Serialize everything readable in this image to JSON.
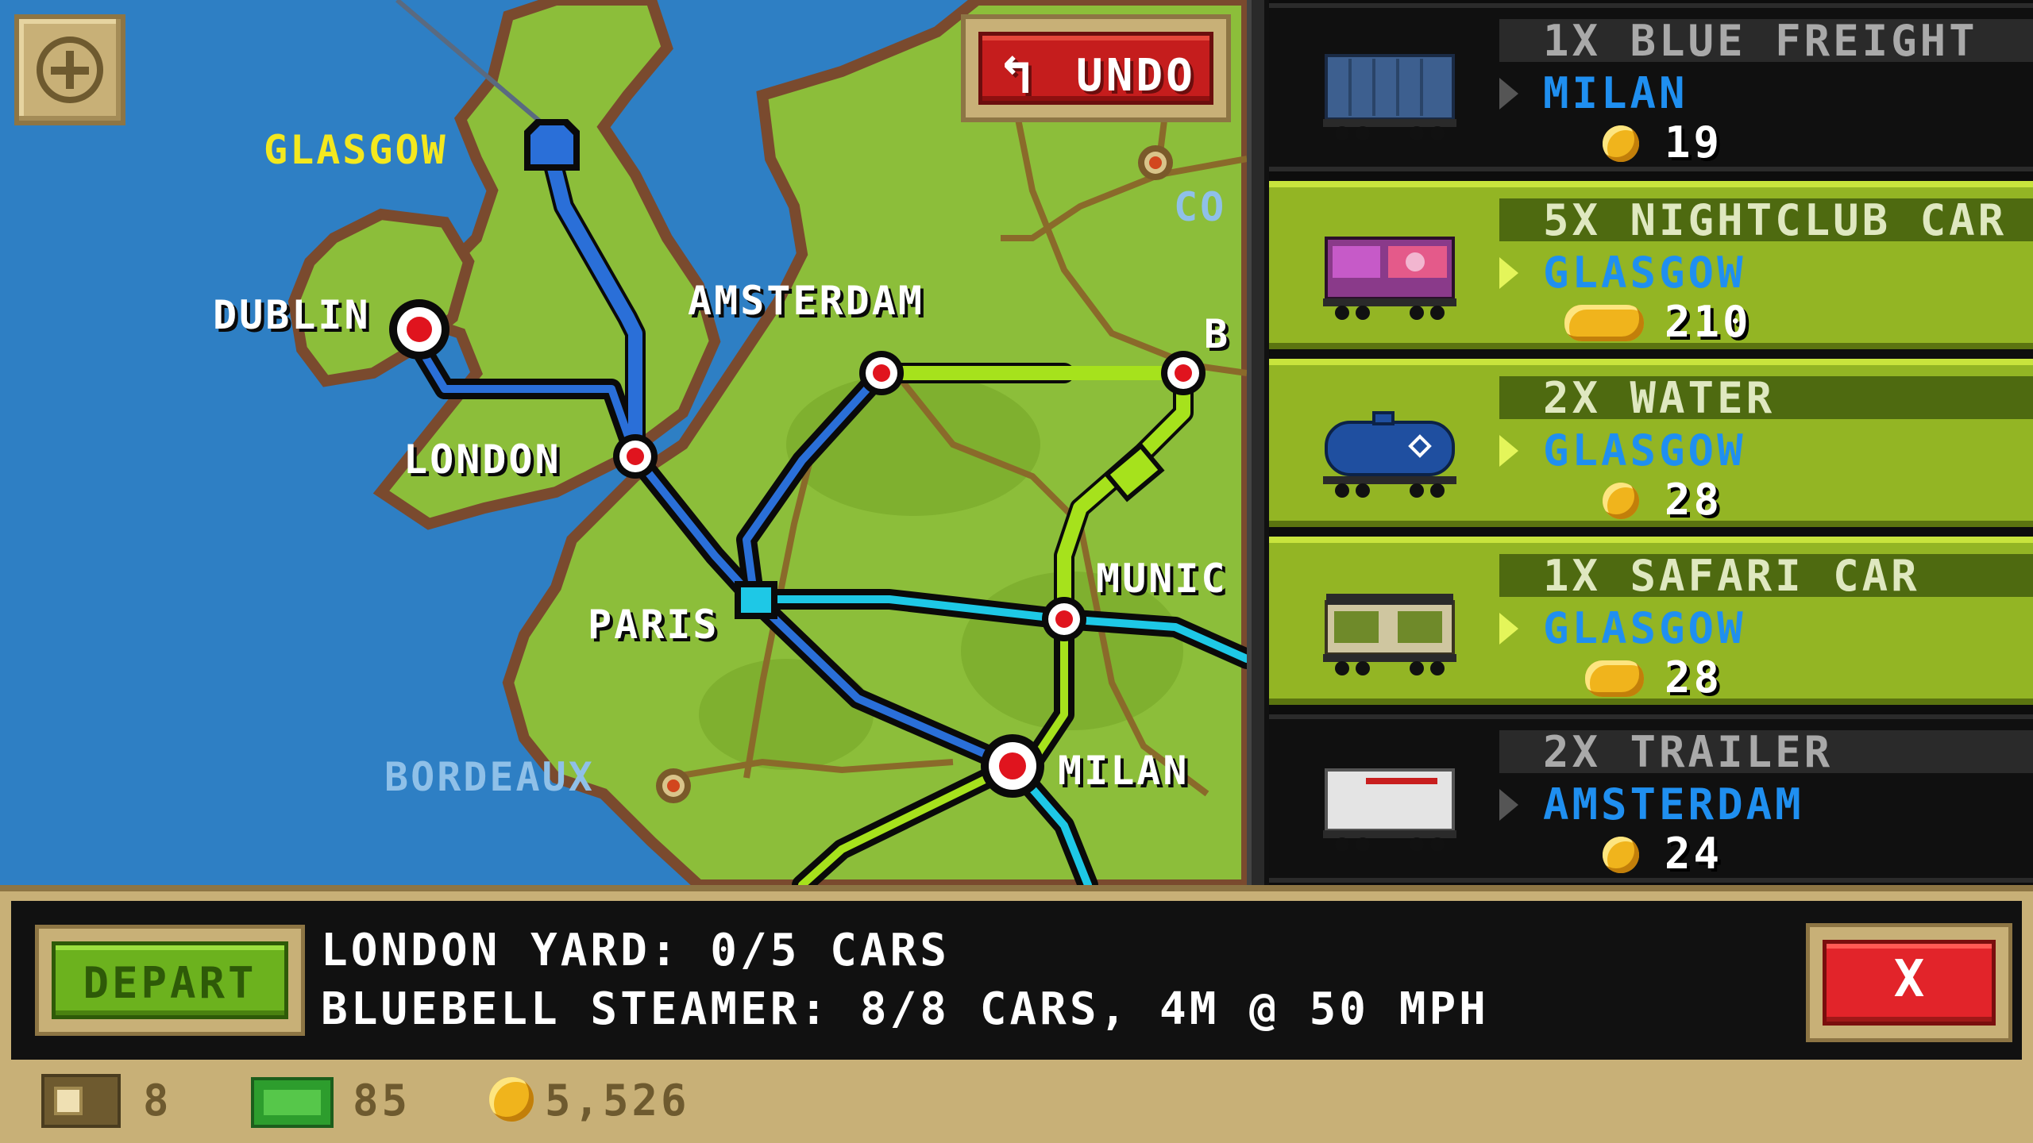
{
  "map": {
    "cities": {
      "glasgow": "GLASGOW",
      "dublin": "DUBLIN",
      "amsterdam": "AMSTERDAM",
      "london": "LONDON",
      "paris": "PARIS",
      "munich": "MUNIC",
      "bordeaux": "BORDEAUX",
      "milan": "MILAN",
      "partial_right_top": "CO",
      "partial_right_mid": "B"
    },
    "undo_label": "UNDO",
    "zoom_icon": "plus-icon"
  },
  "cargo": [
    {
      "quantity_name": "1X BLUE FREIGHT",
      "destination": "MILAN",
      "price": "19",
      "selected": false
    },
    {
      "quantity_name": "5X NIGHTCLUB CAR",
      "destination": "GLASGOW",
      "price": "210",
      "selected": true
    },
    {
      "quantity_name": "2X WATER",
      "destination": "GLASGOW",
      "price": "28",
      "selected": true
    },
    {
      "quantity_name": "1X SAFARI CAR",
      "destination": "GLASGOW",
      "price": "28",
      "selected": true
    },
    {
      "quantity_name": "2X TRAILER",
      "destination": "AMSTERDAM",
      "price": "24",
      "selected": false
    }
  ],
  "footer": {
    "depart_label": "DEPART",
    "line1": "LONDON YARD: 0/5 CARS",
    "line2": "BLUEBELL STEAMER: 8/8 CARS, 4M @ 50 MPH",
    "close_label": "X"
  },
  "status": {
    "crates": "8",
    "cash": "85",
    "coins": "5,526"
  },
  "colors": {
    "water": "#2e7fc4",
    "land": "#8cbe3a",
    "panel_selected": "#93b524",
    "destination_blue": "#1f8ff0",
    "track_lime": "#a6e21c",
    "track_blue": "#2a6fd8",
    "track_cyan": "#1ec8e6"
  }
}
